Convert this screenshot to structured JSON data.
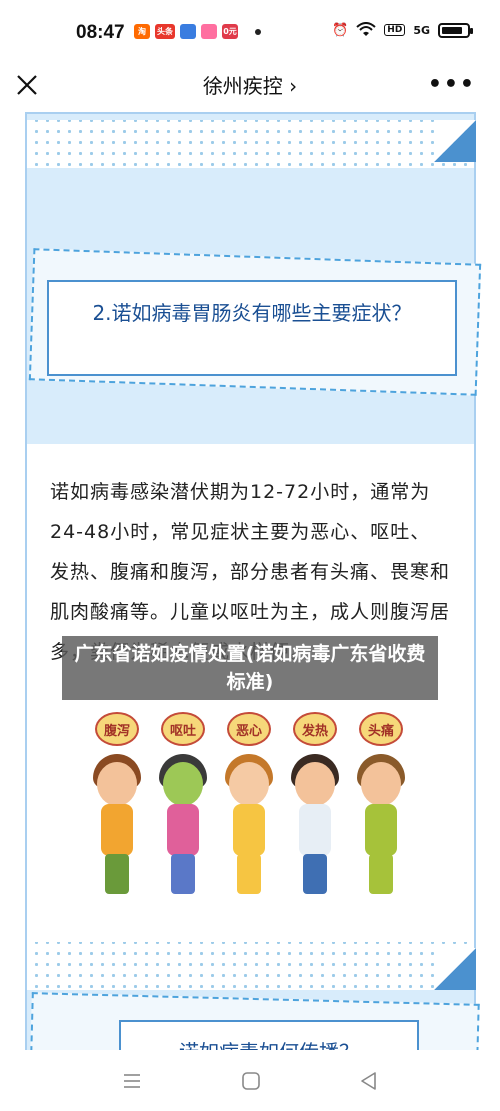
{
  "status_bar": {
    "time": "08:47",
    "app_icons": [
      {
        "name": "taobao-icon",
        "label": "淘",
        "color": "#ff6a00"
      },
      {
        "name": "toutiao-icon",
        "label": "头条",
        "color": "#e8372c"
      },
      {
        "name": "stack-icon",
        "label": "",
        "color": "#3a7de0"
      },
      {
        "name": "game-icon",
        "label": "",
        "color": "#ff6fa0"
      },
      {
        "name": "deal-icon",
        "label": "0元",
        "color": "#e03a4a"
      }
    ],
    "signal_text": "HD",
    "network_text": "5G",
    "battery_level": 0.85
  },
  "nav": {
    "title": "徐州疾控 ›"
  },
  "article": {
    "question": "2.诺如病毒胃肠炎有哪些主要症状？",
    "paragraph": "诺如病毒感染潜伏期为12-72小时，通常为24-48小时，常见症状主要为恶心、呕吐、发热、腹痛和腹泻，部分患者有头痛、畏寒和肌肉酸痛等。儿童以呕吐为主，成人则腹泻居多，粪便为稀水便或水样便。",
    "symptom_tags": [
      "腹泻",
      "呕吐",
      "恶心",
      "发热",
      "头痛"
    ],
    "next_heading": "诺如病毒如何传播？"
  },
  "overlay": {
    "title": "广东省诺如疫情处置(诺如病毒广东省收费标准)"
  },
  "colors": {
    "accent": "#4b91cf",
    "card_bg": "#d8ecfb",
    "heading_text": "#1a4f93"
  }
}
